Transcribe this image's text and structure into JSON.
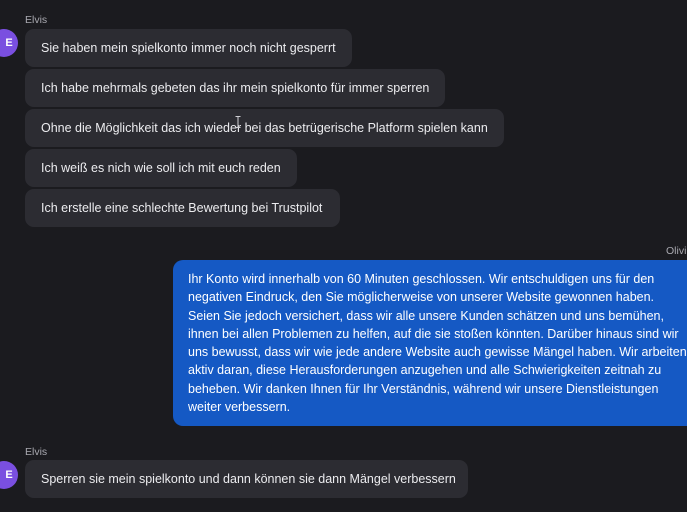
{
  "conversation": {
    "group1": {
      "sender": "Elvis",
      "avatar_initial": "E",
      "avatar_color": "#7a4fe0",
      "messages": [
        "Sie haben mein spielkonto immer noch nicht gesperrt",
        "Ich habe mehrmals gebeten das ihr mein spielkonto für immer sperren",
        "Ohne die Möglichkeit das ich wieder bei das betrügerische Platform spielen kann",
        "Ich weiß es nich wie soll ich mit euch reden",
        "Ich erstelle eine schlechte Bewertung bei Trustpilot"
      ]
    },
    "group2": {
      "sender": "Olivi",
      "bubble_color": "#1559c4",
      "messages": [
        "Ihr Konto wird innerhalb von 60 Minuten geschlossen. Wir entschuldigen uns für den negativen Eindruck, den Sie möglicherweise von unserer Website gewonnen haben. Seien Sie jedoch versichert, dass wir alle unsere Kunden schätzen und uns bemühen, ihnen bei allen Problemen zu helfen, auf die sie stoßen könnten. Darüber hinaus sind wir uns bewusst, dass wir wie jede andere Website auch gewisse Mängel haben. Wir arbeiten aktiv daran, diese Herausforderungen anzugehen und alle Schwierigkeiten zeitnah zu beheben. Wir danken Ihnen für Ihr Verständnis, während wir unsere Dienstleistungen weiter verbessern."
      ]
    },
    "group3": {
      "sender": "Elvis",
      "avatar_initial": "E",
      "avatar_color": "#7a4fe0",
      "messages": [
        "Sperren sie mein spielkonto und dann können sie dann Mängel verbessern"
      ]
    }
  }
}
